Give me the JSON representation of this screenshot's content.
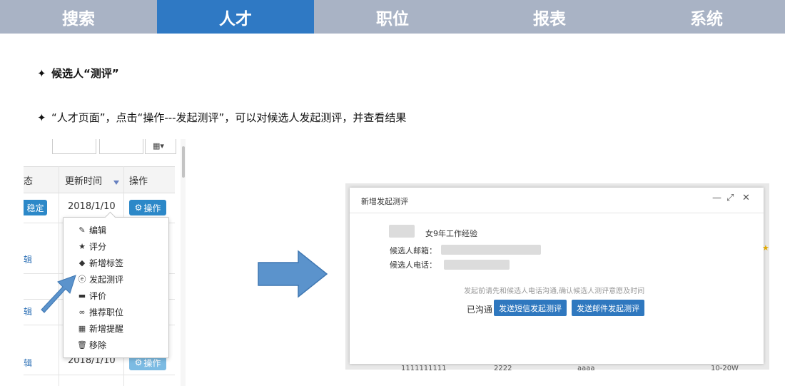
{
  "nav": {
    "tabs": [
      {
        "label": "搜索"
      },
      {
        "label": "人才"
      },
      {
        "label": "职位"
      },
      {
        "label": "报表"
      },
      {
        "label": "系统"
      }
    ],
    "active_index": 1
  },
  "bullets": [
    {
      "text": "候选人“测评”"
    },
    {
      "text": "“人才页面”，点击“操作---发起测评”，可以对候选人发起测评，并查看结果"
    }
  ],
  "left_panel": {
    "header": {
      "col1": "态",
      "col2": "更新时间",
      "col3": "操作"
    },
    "rows": [
      {
        "status": "稳定",
        "date": "2018/1/10",
        "action": "操作"
      },
      {
        "edit": "辑"
      },
      {
        "edit": "辑"
      },
      {
        "edit": "辑",
        "date": "2018/1/10",
        "action": "操作"
      }
    ],
    "menu_items": [
      {
        "label": "编辑",
        "icon": "pencil-icon"
      },
      {
        "label": "评分",
        "icon": "star-icon"
      },
      {
        "label": "新增标签",
        "icon": "tag-icon"
      },
      {
        "label": "发起测评",
        "icon": "assessment-icon"
      },
      {
        "label": "评价",
        "icon": "comment-icon"
      },
      {
        "label": "推荐职位",
        "icon": "link-icon"
      },
      {
        "label": "新增提醒",
        "icon": "calendar-icon"
      },
      {
        "label": "移除",
        "icon": "trash-icon"
      }
    ]
  },
  "dialog": {
    "title": "新增发起测评",
    "candidate_info": "女9年工作经验",
    "email_label": "候选人邮箱：",
    "phone_label": "候选人电话：",
    "hint": "发起前请先和候选人电话沟通,确认候选人测评意愿及时间",
    "communicated": "已沟通",
    "btn_sms": "发送短信发起测评",
    "btn_email": "发送邮件发起测评",
    "background_row": [
      "1111111111",
      "2222",
      "aaaa",
      "10-20W"
    ]
  },
  "colors": {
    "nav_bg": "#a9b3c5",
    "nav_active": "#2f79c4",
    "accent": "#2c88c8",
    "arrow": "#5b93cc"
  }
}
